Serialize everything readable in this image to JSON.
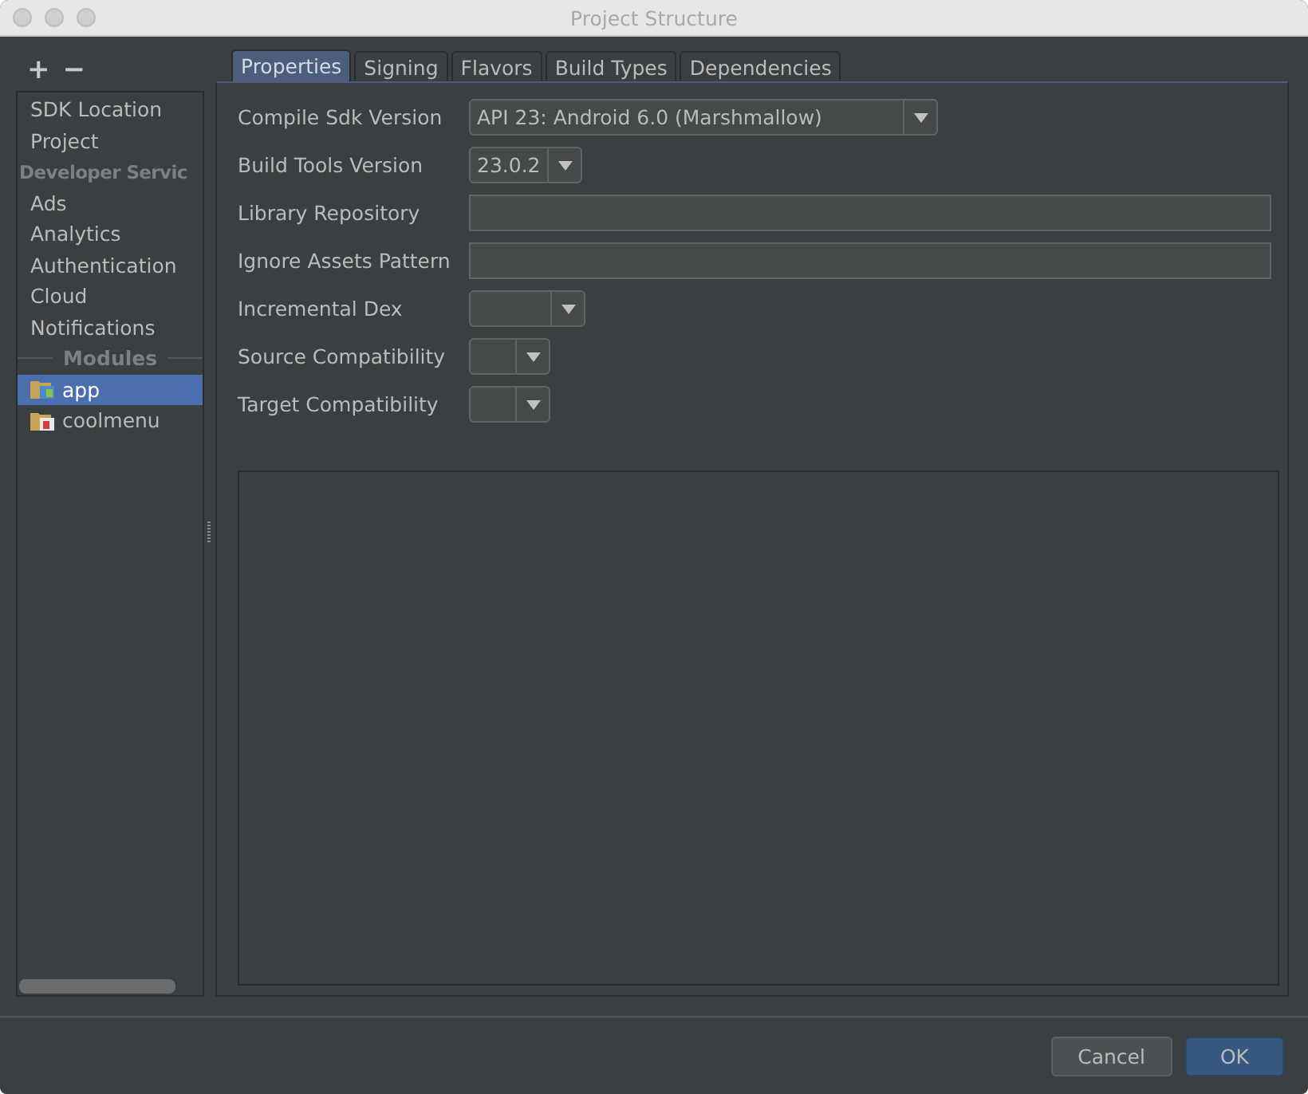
{
  "window": {
    "title": "Project Structure"
  },
  "sidebar": {
    "add": "+",
    "remove": "−",
    "items": [
      {
        "kind": "item",
        "label": "SDK Location",
        "selected": false
      },
      {
        "kind": "item",
        "label": "Project",
        "selected": false
      },
      {
        "kind": "header",
        "label": "Developer Servic"
      },
      {
        "kind": "item",
        "label": "Ads",
        "selected": false
      },
      {
        "kind": "item",
        "label": "Analytics",
        "selected": false
      },
      {
        "kind": "item",
        "label": "Authentication",
        "selected": false
      },
      {
        "kind": "item",
        "label": "Cloud",
        "selected": false
      },
      {
        "kind": "item",
        "label": "Notifications",
        "selected": false
      },
      {
        "kind": "separator",
        "label": "Modules"
      },
      {
        "kind": "module",
        "label": "app",
        "selected": true
      },
      {
        "kind": "module",
        "label": "coolmenu",
        "selected": false
      }
    ]
  },
  "tabs": [
    {
      "label": "Properties",
      "selected": true
    },
    {
      "label": "Signing",
      "selected": false
    },
    {
      "label": "Flavors",
      "selected": false
    },
    {
      "label": "Build Types",
      "selected": false
    },
    {
      "label": "Dependencies",
      "selected": false
    }
  ],
  "fields": [
    {
      "kind": "combo",
      "label": "Compile Sdk Version",
      "value": "API 23: Android 6.0 (Marshmallow)"
    },
    {
      "kind": "combo",
      "label": "Build Tools Version",
      "value": "23.0.2"
    },
    {
      "kind": "text",
      "label": "Library Repository"
    },
    {
      "kind": "text",
      "label": "Ignore Assets Pattern"
    },
    {
      "kind": "combo",
      "label": "Incremental Dex"
    },
    {
      "kind": "combo",
      "label": "Source Compatibility"
    },
    {
      "kind": "combo",
      "label": "Target Compatibility"
    }
  ],
  "buttons": [
    {
      "label": "Cancel",
      "primary": false
    },
    {
      "label": "OK",
      "primary": true
    }
  ]
}
